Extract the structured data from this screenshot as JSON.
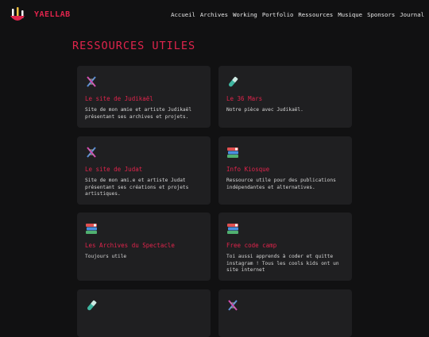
{
  "brand": {
    "name": "YAELLAB"
  },
  "nav": [
    "Accueil",
    "Archives",
    "Working",
    "Portfolio",
    "Ressources",
    "Musique",
    "Sponsors",
    "Journal"
  ],
  "page": {
    "title": "RESSOURCES UTILES"
  },
  "cards": [
    {
      "icon": "dna-icon",
      "title": "Le site de Judikaël",
      "desc": "Site de mon amie et artiste Judikaël présentant ses archives et projets."
    },
    {
      "icon": "test-tube-icon",
      "title": "Le 36 Mars",
      "desc": "Notre pièce avec Judikaël."
    },
    {
      "icon": "dna-icon",
      "title": "Le site de Judat",
      "desc": "Site de mon ami.e et artiste Judat présentant ses créations et projets artistiques."
    },
    {
      "icon": "books-icon",
      "title": "Info Kiosque",
      "desc": "Ressource utile pour des publications indépendantes et alternatives."
    },
    {
      "icon": "books-icon",
      "title": "Les Archives du Spectacle",
      "desc": "Toujours utile"
    },
    {
      "icon": "books-icon",
      "title": "Free code camp",
      "desc": "Toi aussi apprends à coder et quitte instagram ! Tous les cools kids ont un site internet"
    },
    {
      "icon": "test-tube-icon",
      "title": "",
      "desc": ""
    },
    {
      "icon": "dna-icon",
      "title": "",
      "desc": ""
    }
  ],
  "colors": {
    "accent": "#e0244c",
    "card_bg": "#1f1f21",
    "page_bg": "#111112"
  }
}
